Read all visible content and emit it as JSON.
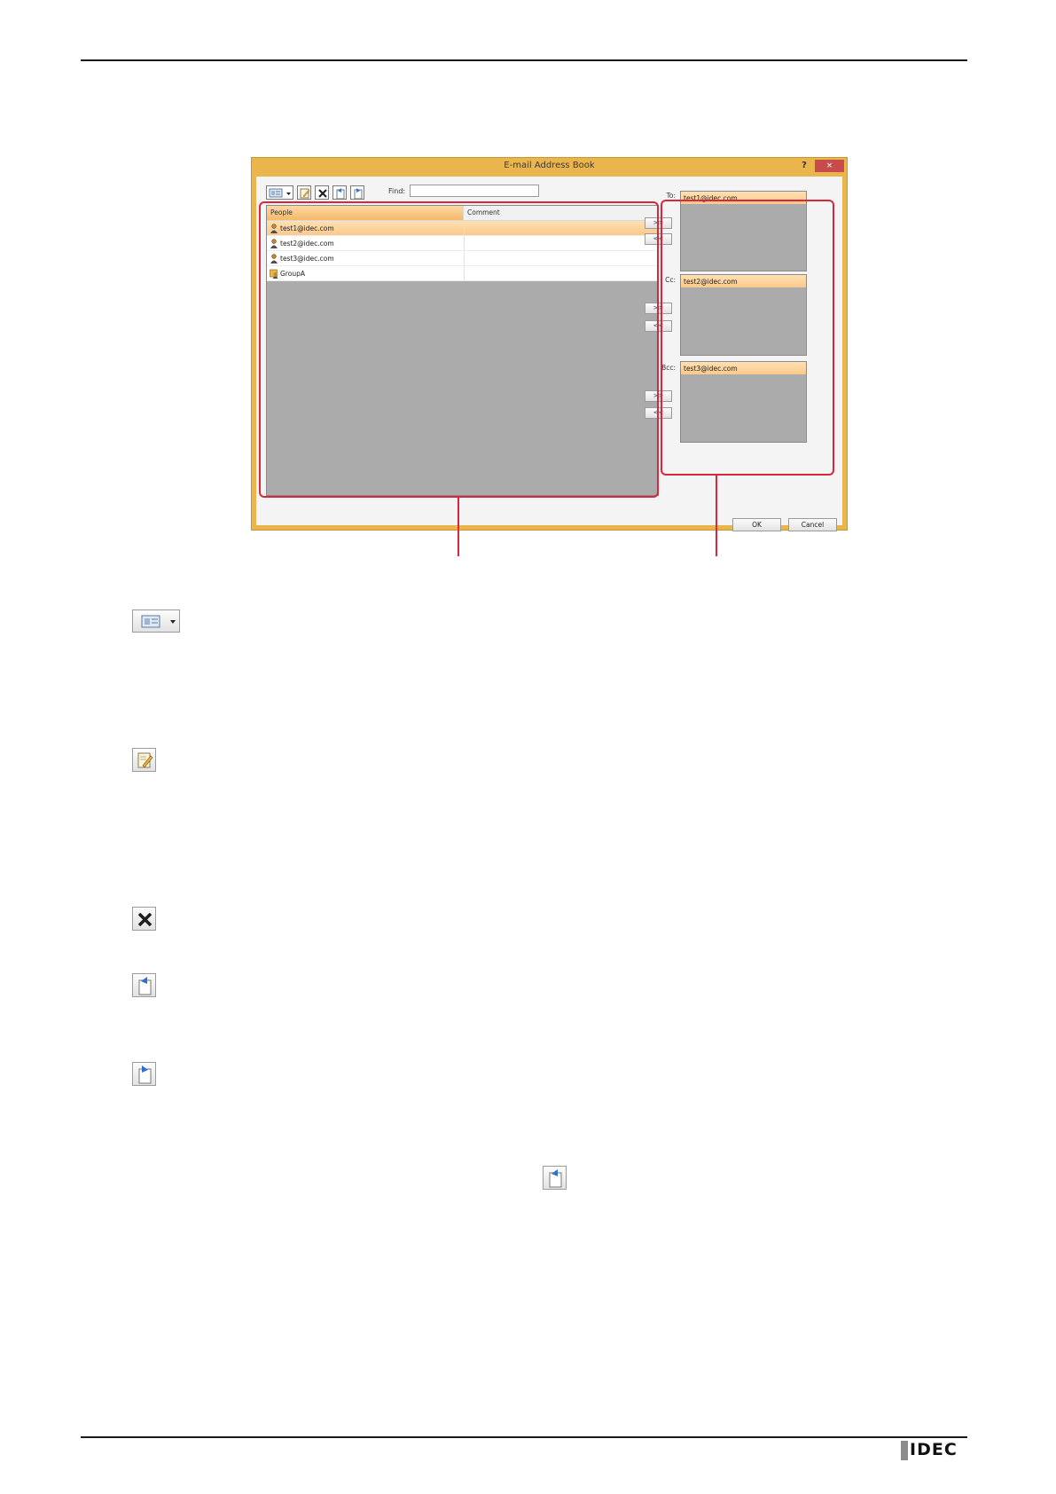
{
  "dialog": {
    "title": "E-mail Address Book",
    "help_label": "?",
    "close_label": "×",
    "find_label": "Find:",
    "find_value": "",
    "columns": {
      "people": "People",
      "comment": "Comment"
    },
    "people": [
      {
        "name": "test1@idec.com",
        "type": "person",
        "selected": true
      },
      {
        "name": "test2@idec.com",
        "type": "person",
        "selected": false
      },
      {
        "name": "test3@idec.com",
        "type": "person",
        "selected": false
      },
      {
        "name": "GroupA",
        "type": "group",
        "selected": false
      }
    ],
    "recipients": {
      "to": {
        "label": "To:",
        "items": [
          "test1@idec.com"
        ]
      },
      "cc": {
        "label": "Cc:",
        "items": [
          "test2@idec.com"
        ]
      },
      "bcc": {
        "label": "Bcc:",
        "items": [
          "test3@idec.com"
        ]
      }
    },
    "add_label": ">>",
    "remove_label": "<<",
    "ok_label": "OK",
    "cancel_label": "Cancel"
  },
  "toolbar_icons": [
    "view-dropdown-icon",
    "new-entry-icon",
    "delete-icon",
    "import-icon",
    "export-icon"
  ],
  "colors": {
    "window_frame": "#ebb54d",
    "selection": "#fbc98b",
    "callout": "#d9283d",
    "list_background": "#ababab"
  },
  "brand": {
    "logo_text": "IDEC"
  }
}
